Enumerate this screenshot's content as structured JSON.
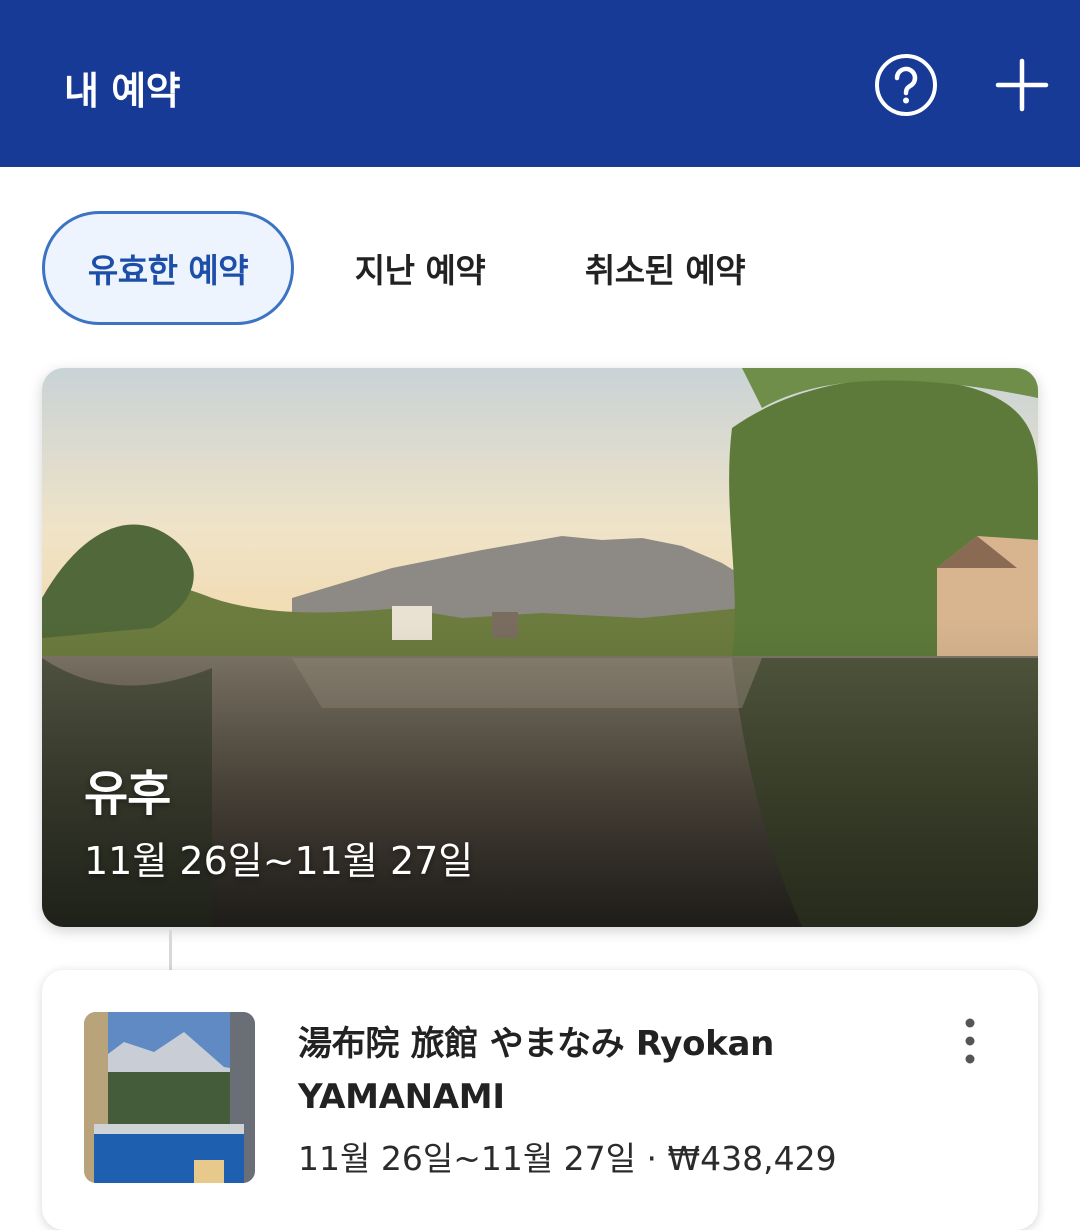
{
  "header": {
    "title": "내 예약",
    "help_icon": "help-circle-icon",
    "add_icon": "plus-icon",
    "background": "#173a96"
  },
  "tabs": [
    {
      "label": "유효한 예약",
      "active": true
    },
    {
      "label": "지난 예약",
      "active": false
    },
    {
      "label": "취소된 예약",
      "active": false
    }
  ],
  "destination": {
    "name": "유후",
    "dates": "11월 26일~11월 27일"
  },
  "booking": {
    "name": "湯布院 旅館 やまなみ Ryokan YAMANAMI",
    "dates": "11월 26일~11월 27일",
    "separator": "·",
    "price": "₩438,429",
    "more_icon": "more-vertical-icon"
  },
  "colors": {
    "accent": "#3c73c2",
    "active_tab_text": "#1e4fa8"
  }
}
